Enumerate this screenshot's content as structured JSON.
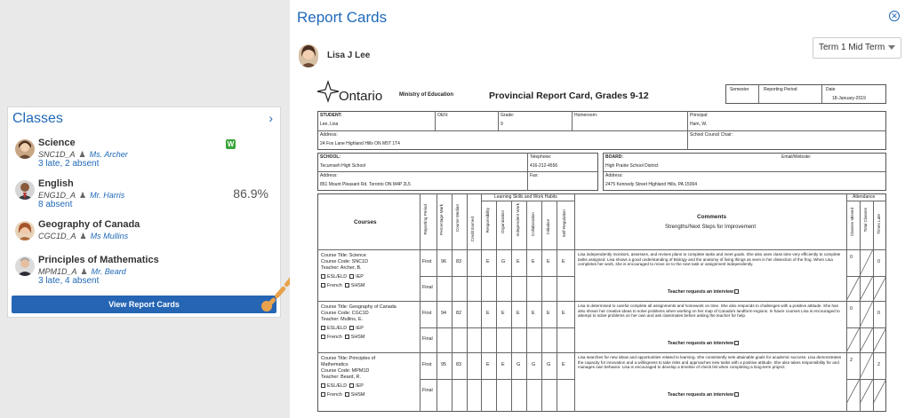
{
  "classes_panel": {
    "title": "Classes",
    "chevron": "chevron-right-icon",
    "classes": [
      {
        "name": "Science",
        "code": "SNC1D_A",
        "teacher": "Ms. Archer",
        "status": "3 late, 2 absent",
        "badge": "W",
        "grade": ""
      },
      {
        "name": "English",
        "code": "ENG1D_A",
        "teacher": "Mr. Harris",
        "status": "8 absent",
        "badge": "",
        "grade": "86.9%"
      },
      {
        "name": "Geography of Canada",
        "code": "CGC1D_A",
        "teacher": "Ms Mullins",
        "status": "",
        "badge": "",
        "grade": ""
      },
      {
        "name": "Principles of Mathematics",
        "code": "MPM1D_A",
        "teacher": "Mr. Beard",
        "status": "3 late, 4 absent",
        "badge": "",
        "grade": ""
      }
    ],
    "button": "View Report Cards"
  },
  "report": {
    "title": "Report Cards",
    "student": "Lisa J Lee",
    "term_select": "Term 1 Mid Term",
    "form": {
      "brand": "Ontario",
      "ministry": "Ministry of Education",
      "title": "Provincial Report Card, Grades 9-12",
      "semester_label": "Semester",
      "period_label": "Reporting Period",
      "date_label": "Date",
      "date": "18-January-2019",
      "student_label": "STUDENT:",
      "student": "Lee, Lisa",
      "oen_label": "OEN:",
      "grade_label": "Grade:",
      "grade": "9",
      "homeroom_label": "Homeroom:",
      "principal_label": "Principal:",
      "principal": "Ham, W.",
      "address_label": "Address:",
      "student_address": "24 Fox Lane Highland Hills ON M5T 1T4",
      "council_label": "School Council Chair:",
      "school_label": "SCHOOL:",
      "school": "Tecumseh High School",
      "telephone_label": "Telephone:",
      "telephone": "416-212-4556",
      "school_address": "851 Mount Pleasant Rd. Toronto ON M4P 2L5",
      "fax_label": "Fax:",
      "board_label": "BOARD:",
      "board": "High Prairie School District",
      "email_label": "Email/Website:",
      "board_address": "2475 Kennedy Street Highland Hills, PA 15004",
      "lsw_header": "Learning Skills and Work Habits",
      "attendance_header": "Attendance",
      "courses_header": "Courses",
      "comments_header": "Comments",
      "comments_sub": "Strengths/Next Steps for Improvement",
      "col_headers": [
        "Reporting Period",
        "Percentage Mark",
        "Course Median",
        "Credit Earned",
        "Responsibility",
        "Organization",
        "Independent Work",
        "Collaboration",
        "Initiative",
        "Self-Regulation"
      ],
      "att_headers": [
        "Classes Missed",
        "Total Classes",
        "Times Late"
      ],
      "esl_label": "ESL/ELD",
      "iep_label": "IEP",
      "french_label": "French",
      "shsm_label": "SHSM",
      "interview_label": "Teacher requests an interview",
      "final_label": "Final",
      "courses": [
        {
          "title_lines": [
            "Course Title: Science"
          ],
          "code": "Course Code: SNC1D",
          "teacher": "Teacher: Archer, B.",
          "period": "First",
          "mark": "96",
          "median": "83",
          "skills": [
            "E",
            "G",
            "E",
            "E",
            "E",
            "E"
          ],
          "comment": "Lisa independently monitors, assesses, and revises plans to complete tasks and meet goals. She also uses class time very efficiently to complete tasks assigned. Lisa shows a good understanding of Biology and the anatomy of living things as seen in her dissection of the frog. When Lisa completes her work, she is encouraged to move on to the next task or assignment independently.",
          "missed": "0",
          "late": "0"
        },
        {
          "title_lines": [
            "Course Title: Geography of Canada"
          ],
          "code": "Course Code: CGC1D",
          "teacher": "Teacher: Mullins, E.",
          "period": "First",
          "mark": "94",
          "median": "82",
          "skills": [
            "E",
            "E",
            "E",
            "E",
            "E",
            "E"
          ],
          "comment": "Lisa is determined to careful complete all assignments and homework on time. She also responds to challenges with a positive attitude. She has also shown her creative ideas to solve problems when working on her map of Canada's landform-regions. In future courses Lisa is encouraged to attempt to solve problems on her own and ask classmates before asking the teacher for help.",
          "missed": "0",
          "late": "0"
        },
        {
          "title_lines": [
            "Course Title: Principles of",
            "Mathematics"
          ],
          "code": "Course Code: MPM1D",
          "teacher": "Teacher: Beard, R.",
          "period": "First",
          "mark": "95",
          "median": "83",
          "skills": [
            "E",
            "E",
            "G",
            "G",
            "G",
            "E"
          ],
          "comment": "Lisa searches for new ideas and opportunities related to learning. She consistently sets attainable goals for academic success. Lisa demonstrates the capacity for innovation and a willingness to take risks and approaches new tasks with a positive attitude. She also takes responsibility for and manages own behavior. Lisa is encouraged to develop a timeline of check list when completing a long-term project.",
          "missed": "2",
          "late": "2"
        }
      ]
    }
  },
  "colors": {
    "accent": "#1f69b8",
    "button": "#2565b4",
    "badge": "#3aa53a",
    "arrow": "#e9a24b"
  }
}
